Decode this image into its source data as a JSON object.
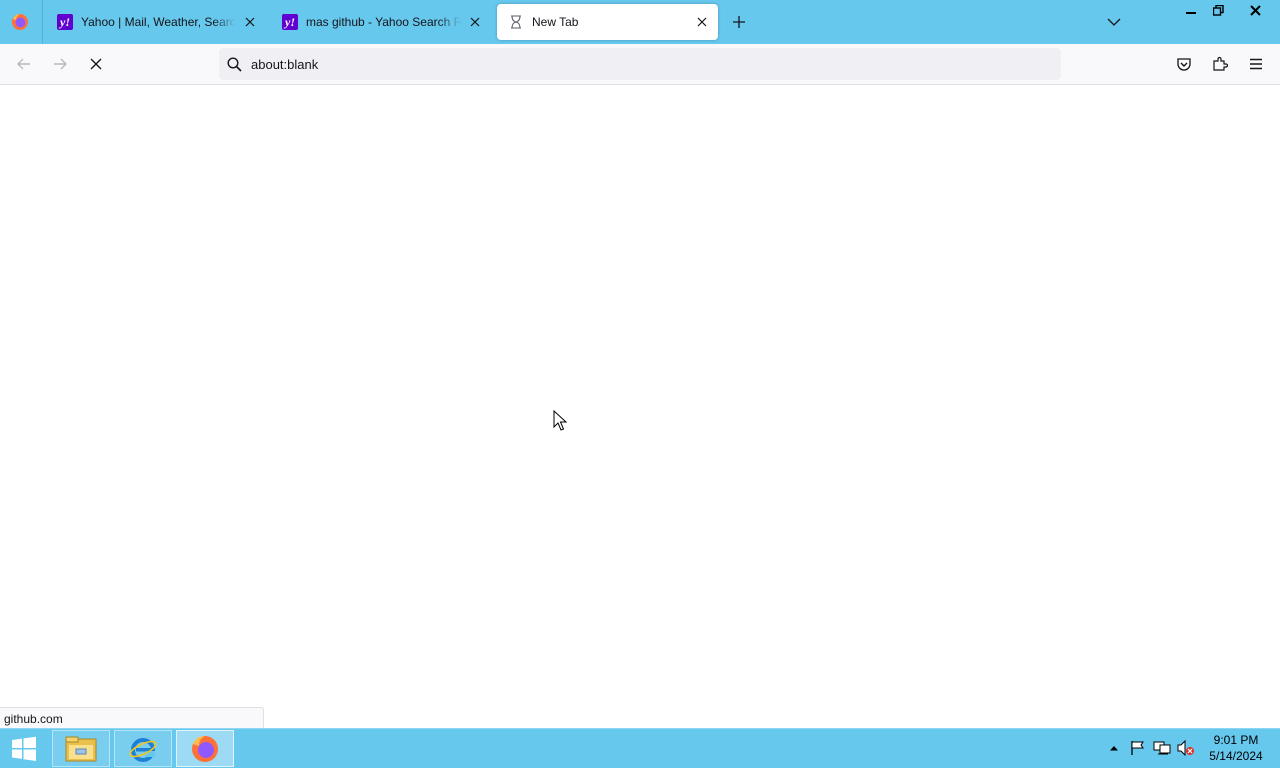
{
  "tabs": [
    {
      "title": "Yahoo | Mail, Weather, Search, Politics, News, Finance, Sports & Videos",
      "favicon": "yahoo-favicon"
    },
    {
      "title": "mas github - Yahoo Search Results",
      "favicon": "yahoo-favicon"
    },
    {
      "title": "New Tab",
      "favicon": "loading-hourglass-icon"
    }
  ],
  "urlbar": {
    "value": "about:blank"
  },
  "status": {
    "text": "github.com"
  },
  "clock": {
    "time": "9:01 PM",
    "date": "5/14/2024"
  },
  "taskbar": {
    "apps": [
      "file-explorer-icon",
      "internet-explorer-icon",
      "firefox-icon"
    ]
  },
  "colors": {
    "accent": "#67c8ed",
    "yahoo": "#6001d2"
  }
}
